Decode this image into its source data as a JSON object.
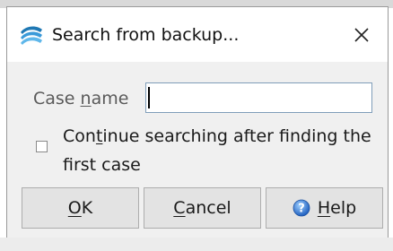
{
  "dialog": {
    "title": "Search from backup...",
    "app_icon": "stacked-waves-icon",
    "close_icon": "close-icon"
  },
  "form": {
    "case_name": {
      "label_pre": "Case ",
      "label_mnemonic": "n",
      "label_post": "ame",
      "value": ""
    },
    "continue_search": {
      "checked": false,
      "label_pre": "Con",
      "label_mnemonic": "t",
      "label_post": "inue searching after finding the first case"
    }
  },
  "buttons": {
    "ok": {
      "mnemonic": "O",
      "rest": "K"
    },
    "cancel": {
      "mnemonic": "C",
      "rest": "ancel"
    },
    "help": {
      "mnemonic": "H",
      "rest": "elp",
      "icon": "help-icon"
    }
  }
}
